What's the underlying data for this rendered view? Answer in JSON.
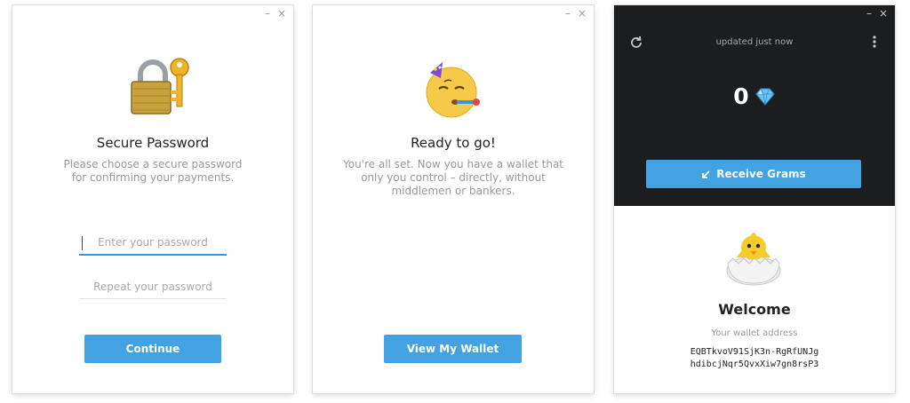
{
  "window1": {
    "minimize": "–",
    "close": "×",
    "title": "Secure Password",
    "subtitle_lines": [
      "Please choose a secure password",
      "for confirming your payments."
    ],
    "password_placeholder": "Enter your password",
    "repeat_placeholder": "Repeat your password",
    "continue_label": "Continue",
    "icon": "lock-and-key-icon"
  },
  "window2": {
    "minimize": "–",
    "close": "×",
    "title": "Ready to go!",
    "subtitle_lines": [
      "You're all set. Now you have a wallet that",
      "only you control – directly, without",
      "middlemen or bankers."
    ],
    "view_wallet_label": "View My Wallet",
    "icon": "party-face-icon"
  },
  "window3": {
    "minimize": "–",
    "close": "×",
    "status": "updated just now",
    "balance": "0",
    "receive_label": "Receive Grams",
    "welcome_title": "Welcome",
    "address_label": "Your wallet address",
    "address_lines": [
      "EQBTkvoV91SjK3n-RgRfUNJg",
      "hdibcjNqr5QvxXiw7gn8rsP3"
    ],
    "icon": "hatching-chick-icon"
  },
  "colors": {
    "accent": "#42a2e2",
    "dark_header": "#1c1d1f"
  }
}
